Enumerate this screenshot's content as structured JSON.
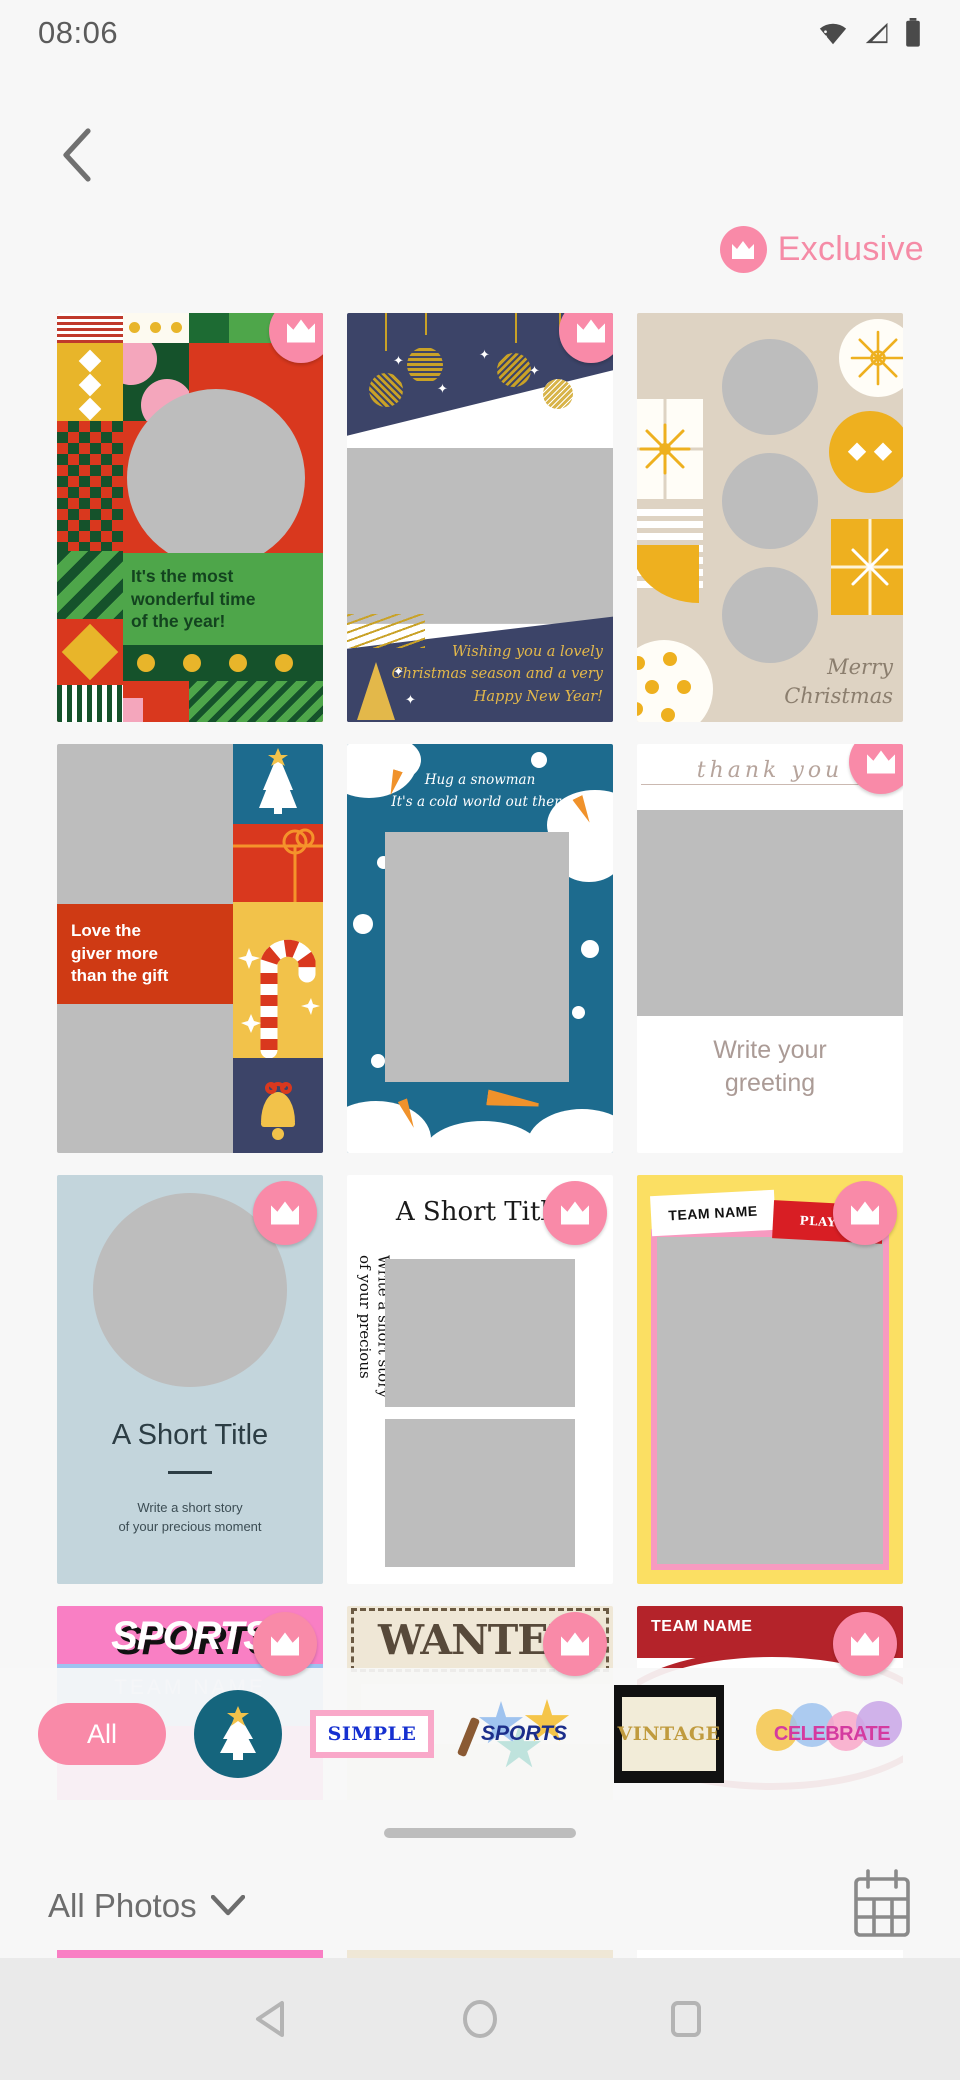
{
  "status_bar": {
    "time": "08:06",
    "icons": [
      "wifi-icon",
      "cellular-signal-icon",
      "battery-icon"
    ]
  },
  "header": {
    "back_icon": "chevron-left-icon",
    "exclusive_label": "Exclusive",
    "exclusive_badge_icon": "crown-icon",
    "accent_pink": "#f98aa8"
  },
  "templates": [
    {
      "id": "christmas-patterns",
      "message": "It's the most\nwonderful time\nof the year!",
      "premium": true,
      "theme": "christmas-geometric",
      "colors": {
        "red": "#d9381e",
        "green": "#4ea64a",
        "dark_green": "#15522b",
        "gold": "#e8b52a",
        "pink": "#f4a6bc"
      }
    },
    {
      "id": "navy-gold-ornaments",
      "message": "Wishing you a lovely\nChristmas season and a very\nHappy New Year!",
      "premium": true,
      "theme": "navy-gold",
      "colors": {
        "navy": "#3c4468",
        "gold": "#e3b84a"
      }
    },
    {
      "id": "merry-christmas-beige",
      "message": "Merry\nChristmas",
      "premium": false,
      "theme": "beige-gold",
      "colors": {
        "beige": "#ded3c3",
        "gold": "#eeb01f"
      }
    },
    {
      "id": "love-the-giver",
      "message": "Love the\ngiver more\nthan the gift",
      "premium": false,
      "theme": "icon-strip",
      "icons": [
        "christmas-tree-icon",
        "gift-box-icon",
        "candy-cane-icon",
        "bell-icon"
      ],
      "colors": {
        "red": "#cf3a14",
        "teal": "#1d6b8e",
        "yellow": "#f2c24a",
        "navy": "#3c4468"
      }
    },
    {
      "id": "hug-a-snowman",
      "message": "Hug a snowman\nIt's a cold world out there",
      "premium": false,
      "theme": "snow-teal",
      "colors": {
        "teal": "#1d6b8e",
        "snow": "#ffffff",
        "carrot": "#f0922b"
      }
    },
    {
      "id": "thank-you-greeting",
      "script_text": "thank you",
      "message": "Write your\ngreeting",
      "premium": true,
      "theme": "minimal-white",
      "colors": {
        "text": "#ab9b96"
      }
    },
    {
      "id": "short-title-blue",
      "title": "A Short Title",
      "subtitle": "Write a short story\nof your precious moment",
      "premium": true,
      "theme": "pastel-blue",
      "colors": {
        "background": "#c3d5dc",
        "text": "#2c3d44"
      }
    },
    {
      "id": "short-title-serif",
      "title": "A Short Title",
      "vertical_text": "Write a short story\nof your precious",
      "premium": true,
      "theme": "editorial-white",
      "colors": {
        "background": "#ffffff",
        "text": "#1a1a1a"
      }
    },
    {
      "id": "team-name-yellow",
      "team_label": "TEAM NAME",
      "player_label": "PLAYER",
      "premium": true,
      "theme": "sports-yellow",
      "colors": {
        "yellow": "#fbdf63",
        "pink": "#f79ac0",
        "red": "#d81e24"
      }
    },
    {
      "id": "sports-pink",
      "title": "SPORTS",
      "team_label": "TEAM NAME",
      "premium": true,
      "theme": "sports-pink",
      "colors": {
        "pink": "#f97fc4",
        "blue": "#9dc3f0"
      }
    },
    {
      "id": "wanted-poster",
      "title": "WANTED",
      "premium": true,
      "theme": "vintage-poster",
      "colors": {
        "paper": "#efe7d6",
        "ink": "#57493a"
      }
    },
    {
      "id": "team-name-red",
      "team_label": "TEAM NAME",
      "premium": true,
      "theme": "sports-red",
      "colors": {
        "red": "#b4232a"
      }
    }
  ],
  "filter_bar": {
    "selected": "All",
    "items": [
      {
        "label": "All",
        "icon": "all-chip",
        "selected": true
      },
      {
        "label": "",
        "icon": "christmas-tree-icon",
        "selected": false
      },
      {
        "label": "SIMPLE",
        "icon": "simple-chip",
        "selected": false
      },
      {
        "label": "SPORTS",
        "icon": "sports-chip",
        "selected": false
      },
      {
        "label": "VINTAGE",
        "icon": "vintage-chip",
        "selected": false
      },
      {
        "label": "CELEBRATE",
        "icon": "celebrate-chip",
        "selected": false
      }
    ]
  },
  "bottom_sheet": {
    "handle_icon": "drag-handle",
    "album_label": "All Photos",
    "dropdown_icon": "chevron-down-icon",
    "calendar_icon": "calendar-icon"
  },
  "nav_bar": {
    "back_icon": "triangle-back-icon",
    "home_icon": "circle-home-icon",
    "recents_icon": "square-recents-icon"
  }
}
